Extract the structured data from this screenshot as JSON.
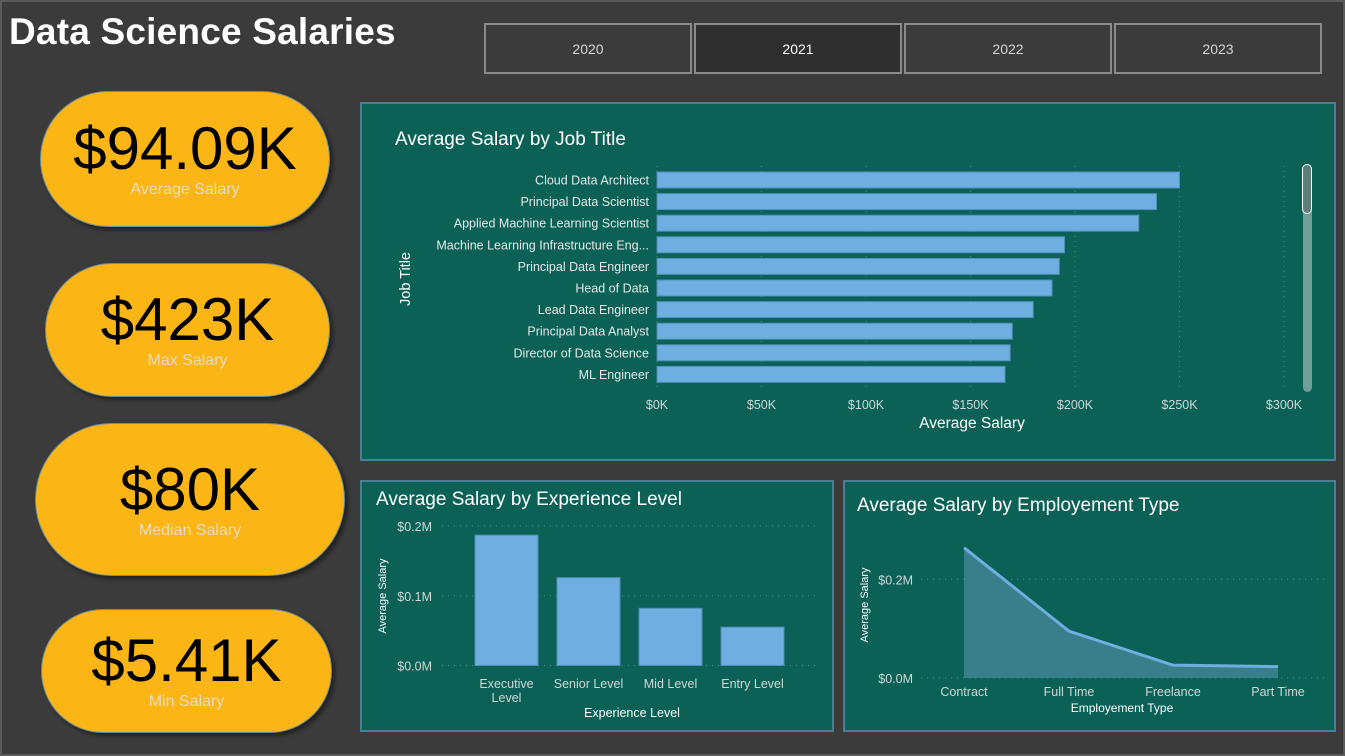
{
  "header": {
    "title": "Data Science Salaries"
  },
  "year_filter": {
    "options": [
      "2020",
      "2021",
      "2022",
      "2023"
    ],
    "selected": "2021"
  },
  "kpis": [
    {
      "value": "$94.09K",
      "label": "Average Salary"
    },
    {
      "value": "$423K",
      "label": "Max Salary"
    },
    {
      "value": "$80K",
      "label": "Median Salary"
    },
    {
      "value": "$5.41K",
      "label": "Min Salary"
    }
  ],
  "colors": {
    "background": "#3b3b3b",
    "panel": "#0c6157",
    "kpi": "#fbb514",
    "bar": "#6eaee0",
    "area_fill": "#387f8b"
  },
  "chart_data": [
    {
      "type": "bar",
      "orientation": "horizontal",
      "title": "Average Salary by Job Title",
      "xlabel": "Average Salary",
      "ylabel": "Job Title",
      "categories": [
        "Cloud Data Architect",
        "Principal Data Scientist",
        "Applied Machine Learning Scientist",
        "Machine Learning Infrastructure Eng...",
        "Principal Data Engineer",
        "Head of Data",
        "Lead Data Engineer",
        "Principal Data Analyst",
        "Director of Data Science",
        "ML Engineer"
      ],
      "values": [
        250000,
        239000,
        230500,
        195000,
        192500,
        189000,
        180000,
        170000,
        169000,
        166500
      ],
      "xlim": [
        0,
        300000
      ],
      "xticks": [
        0,
        50000,
        100000,
        150000,
        200000,
        250000,
        300000
      ],
      "xtick_labels": [
        "$0K",
        "$50K",
        "$100K",
        "$150K",
        "$200K",
        "$250K",
        "$300K"
      ],
      "grid": true,
      "scrollable": true
    },
    {
      "type": "bar",
      "title": "Average Salary by Experience Level",
      "xlabel": "Experience Level",
      "ylabel": "Average Salary",
      "categories": [
        "Executive Level",
        "Senior Level",
        "Mid Level",
        "Entry Level"
      ],
      "category_lines": [
        [
          "Executive",
          "Level"
        ],
        [
          "Senior Level"
        ],
        [
          "Mid Level"
        ],
        [
          "Entry Level"
        ]
      ],
      "values": [
        187000,
        126000,
        82000,
        55000
      ],
      "ylim": [
        0,
        200000
      ],
      "yticks": [
        0,
        100000,
        200000
      ],
      "ytick_labels": [
        "$0.0M",
        "$0.1M",
        "$0.2M"
      ],
      "grid": true
    },
    {
      "type": "area",
      "title": "Average Salary by Employement Type",
      "xlabel": "Employement Type",
      "ylabel": "Average Salary",
      "categories": [
        "Contract",
        "Full Time",
        "Freelance",
        "Part Time"
      ],
      "values": [
        264000,
        95000,
        26000,
        23000
      ],
      "ylim": [
        0,
        300000
      ],
      "yticks": [
        0,
        200000
      ],
      "ytick_labels": [
        "$0.0M",
        "$0.2M"
      ],
      "grid": true
    }
  ]
}
